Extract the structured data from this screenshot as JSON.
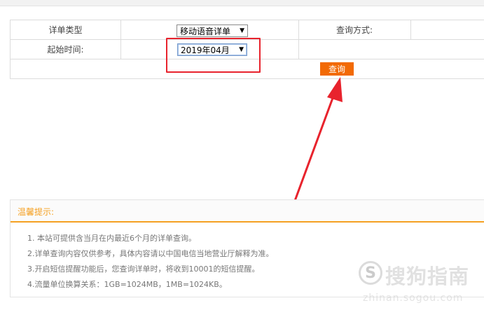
{
  "form": {
    "detail_type_label": "详单类型",
    "detail_type_value": "移动语音详单",
    "query_method_label": "查询方式:",
    "start_time_label": "起始时间:",
    "start_time_value": "2019年04月",
    "query_button": "查询"
  },
  "tips": {
    "title": "温馨提示:",
    "items": [
      "1. 本站可提供含当月在内最近6个月的详单查询。",
      "2.详单查询内容仅供参考，具体内容请以中国电信当地营业厅解释为准。",
      "3.开启短信提醒功能后，您查询详单时，将收到10001的短信提醒。",
      "4.流量单位换算关系：1GB=1024MB，1MB=1024KB。"
    ]
  },
  "watermark": {
    "logo_glyph": "S",
    "text": "搜狗指南",
    "url": "zhinan.sogou.com"
  },
  "colors": {
    "accent_orange": "#f26a05",
    "tips_orange": "#f5a022",
    "annotation_red": "#e8232d"
  }
}
